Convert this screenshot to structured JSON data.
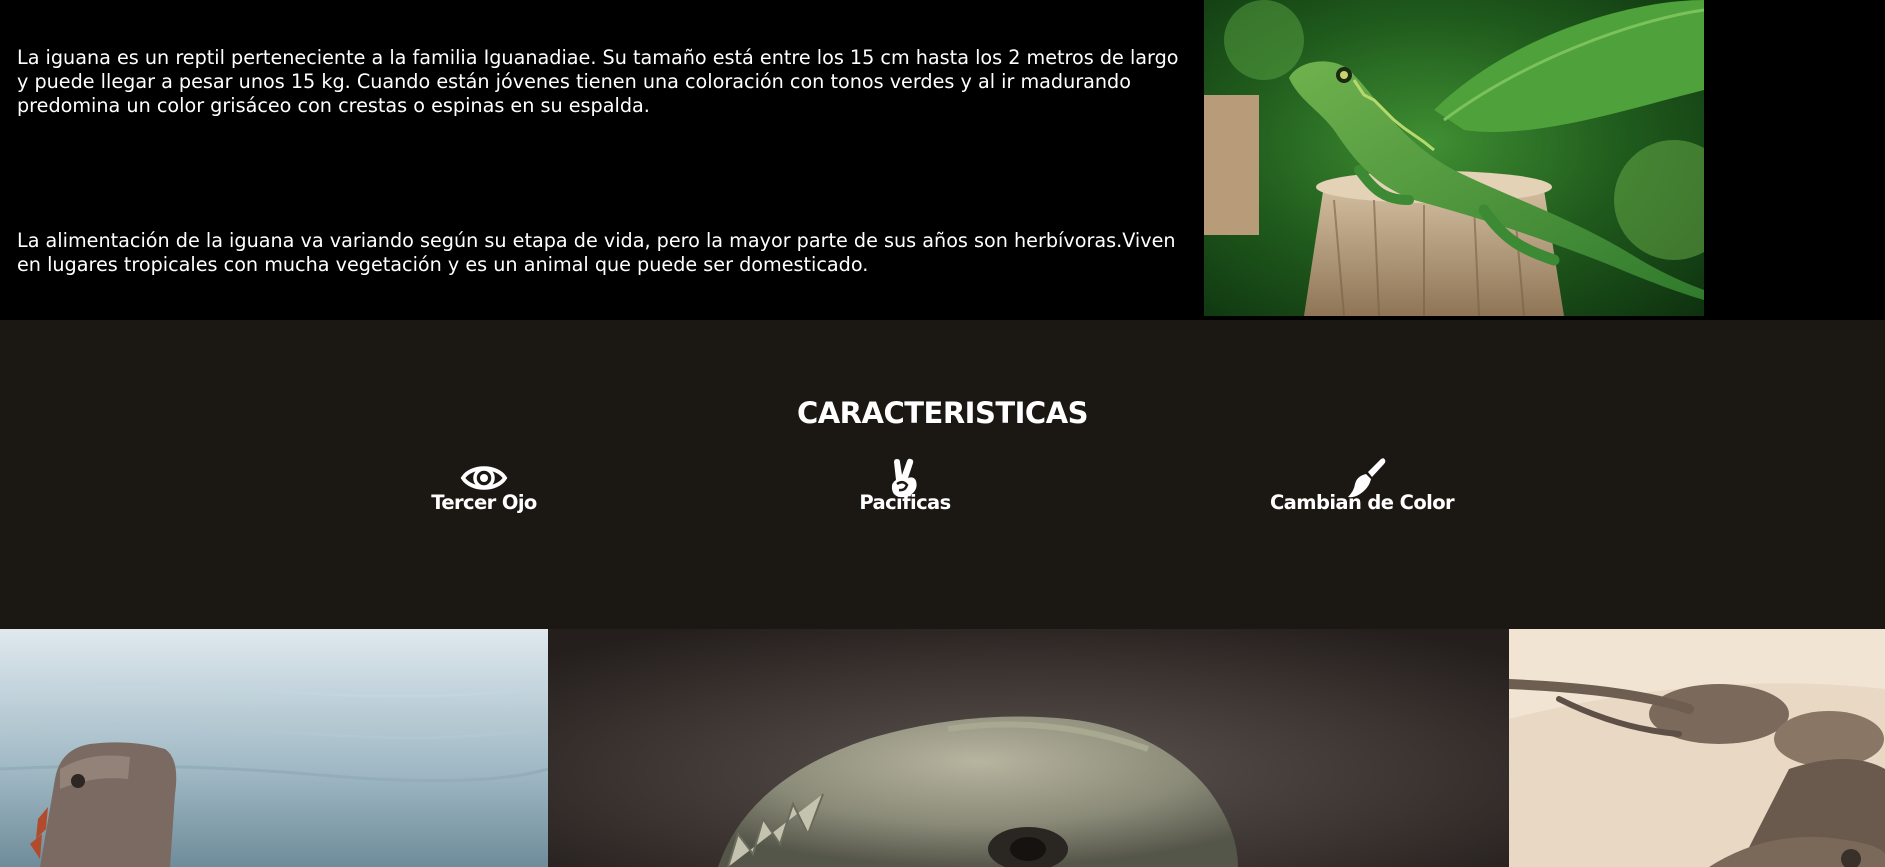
{
  "intro": {
    "paragraph_1": "La iguana es un reptil perteneciente a la familia Iguanadiae. Su tamaño está entre los 15 cm hasta los 2 metros de largo y puede llegar a pesar unos 15 kg. Cuando están jóvenes tienen una coloración con tonos verdes y al ir madurando predomina un color grisáceo con crestas o espinas en su espalda.",
    "paragraph_2": "La alimentación de la iguana va variando según su etapa de vida, pero la mayor parte de sus años son herbívoras.Viven en lugares tropicales con mucha vegetación y es un animal que puede ser domesticado.",
    "photo_icon": "green-iguana-photo"
  },
  "features": {
    "title": "CARACTERISTICAS",
    "items": [
      {
        "icon": "eye-icon",
        "label": "Tercer Ojo"
      },
      {
        "icon": "peace-hand-icon",
        "label": "Pacificas"
      },
      {
        "icon": "paint-brush-icon",
        "label": "Cambian de Color"
      }
    ]
  },
  "gallery": {
    "images": [
      {
        "icon": "iguana-by-sea-photo"
      },
      {
        "icon": "iguana-closeup-photo"
      },
      {
        "icon": "iguanas-on-sand-photo"
      }
    ]
  },
  "colors": {
    "intro_bg": "#000000",
    "features_bg": "#1b1713",
    "text": "#ffffff"
  }
}
